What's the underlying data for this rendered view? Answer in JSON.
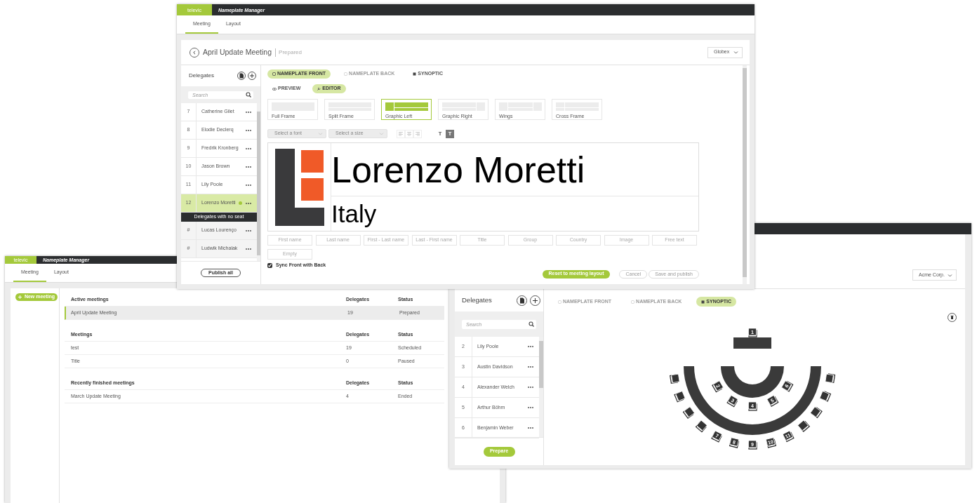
{
  "editor_window": {
    "app": {
      "logo": "televic",
      "title": "Nameplate Manager"
    },
    "tabs": [
      {
        "label": "Meeting",
        "selected": true
      },
      {
        "label": "Layout",
        "selected": false
      }
    ],
    "meeting": {
      "title": "April Update Meeting",
      "status": "Prepared"
    },
    "organisation_select": {
      "value": "Globex"
    },
    "delegates": {
      "title": "Delegates",
      "search": {
        "placeholder": "Search"
      },
      "seated": [
        {
          "seat": "7",
          "name": "Catherine Gilet",
          "selected": false,
          "online": false
        },
        {
          "seat": "8",
          "name": "Elodie Declerq",
          "selected": false,
          "online": false
        },
        {
          "seat": "9",
          "name": "Fredrik Kronberg",
          "selected": false,
          "online": false
        },
        {
          "seat": "10",
          "name": "Jason Brown",
          "selected": false,
          "online": false
        },
        {
          "seat": "11",
          "name": "Lily Poole",
          "selected": false,
          "online": false
        },
        {
          "seat": "12",
          "name": "Lorenzo Moretti",
          "selected": true,
          "online": true
        }
      ],
      "unseated_heading": "Delegates with no seat",
      "unseated": [
        {
          "seat": "#",
          "name": "Lucas Lourenço",
          "selected": false,
          "online": false
        },
        {
          "seat": "#",
          "name": "Ludwik Michalak",
          "selected": false,
          "online": false
        }
      ],
      "publish_button": "Publish all"
    },
    "view_tabs": [
      {
        "label": "NAMEPLATE FRONT",
        "kind": "nameplate",
        "selected": true,
        "disabled": false
      },
      {
        "label": "NAMEPLATE BACK",
        "kind": "nameplate",
        "selected": false,
        "disabled": true
      },
      {
        "label": "SYNOPTIC",
        "kind": "seating",
        "selected": false,
        "disabled": false
      }
    ],
    "mode_tabs": [
      {
        "label": "PREVIEW",
        "kind": "preview",
        "selected": false
      },
      {
        "label": "EDITOR",
        "kind": "editor",
        "selected": true
      }
    ],
    "templates": [
      {
        "label": "Full Frame",
        "kind": "full",
        "selected": false
      },
      {
        "label": "Split Frame",
        "kind": "split",
        "selected": false
      },
      {
        "label": "Graphic Left",
        "kind": "graphic_left",
        "selected": true
      },
      {
        "label": "Graphic Right",
        "kind": "graphic_right",
        "selected": false
      },
      {
        "label": "Wings",
        "kind": "wings",
        "selected": false
      },
      {
        "label": "Cross Frame",
        "kind": "cross",
        "selected": false
      }
    ],
    "font_select": {
      "placeholder": "Select a font"
    },
    "size_select": {
      "placeholder": "Select a size"
    },
    "text_styles": [
      {
        "label": "T",
        "selected": false
      },
      {
        "label": "T",
        "selected": true
      }
    ],
    "nameplate": {
      "name": "Lorenzo Moretti",
      "country": "Italy"
    },
    "fields": [
      "First name",
      "Last name",
      "First - Last name",
      "Last - First name",
      "Title",
      "Group",
      "Country",
      "Image",
      "Free text",
      "Empty"
    ],
    "sync": {
      "label": "Sync Front with Back",
      "checked": true
    },
    "buttons": [
      {
        "label": "Reset to meeting layout",
        "kind": "primary"
      },
      {
        "label": "Cancel",
        "kind": "outline"
      },
      {
        "label": "Save and publish",
        "kind": "outline"
      }
    ]
  },
  "meetings_window": {
    "app": {
      "logo": "televic",
      "title": "Nameplate Manager"
    },
    "tabs": [
      {
        "label": "Meeting",
        "selected": true
      },
      {
        "label": "Layout",
        "selected": false
      }
    ],
    "new_meeting_button": "New meeting",
    "sections": [
      {
        "title": "Active meetings",
        "columns": [
          "Delegates",
          "Status"
        ],
        "rows": [
          {
            "name": "April Update Meeting",
            "delegates": "19",
            "status": "Prepared",
            "selected": true
          }
        ]
      },
      {
        "title": "Meetings",
        "columns": [
          "Delegates",
          "Status"
        ],
        "rows": [
          {
            "name": "test",
            "delegates": "19",
            "status": "Scheduled",
            "selected": false
          },
          {
            "name": "Title",
            "delegates": "0",
            "status": "Paused",
            "selected": false
          }
        ]
      },
      {
        "title": "Recently finished meetings",
        "columns": [
          "Delegates",
          "Status"
        ],
        "rows": [
          {
            "name": "March Update Meeting",
            "delegates": "4",
            "status": "Ended",
            "selected": false
          }
        ]
      }
    ]
  },
  "synoptic_window": {
    "organisation_select": {
      "value": "Acme Corp."
    },
    "delegates": {
      "title": "Delegates",
      "search": {
        "placeholder": "Search"
      },
      "rows": [
        {
          "seat": "2",
          "name": "Lily Poole"
        },
        {
          "seat": "3",
          "name": "Austin Davidson"
        },
        {
          "seat": "4",
          "name": "Alexander Welch"
        },
        {
          "seat": "5",
          "name": "Arthur Böhm"
        },
        {
          "seat": "6",
          "name": "Benjamin Weber"
        }
      ],
      "prepare_button": "Prepare"
    },
    "view_tabs": [
      {
        "label": "NAMEPLATE FRONT",
        "kind": "nameplate",
        "selected": false,
        "disabled": true
      },
      {
        "label": "NAMEPLATE BACK",
        "kind": "nameplate",
        "selected": false,
        "disabled": true
      },
      {
        "label": "SYNOPTIC",
        "kind": "seating",
        "selected": true,
        "disabled": false
      }
    ],
    "seating": {
      "head_seats": [
        "1"
      ],
      "inner_seats": [
        "2",
        "3",
        "4",
        "5",
        "6"
      ],
      "outer_seats": [
        "7",
        "8",
        "9",
        "10",
        "11"
      ]
    }
  }
}
